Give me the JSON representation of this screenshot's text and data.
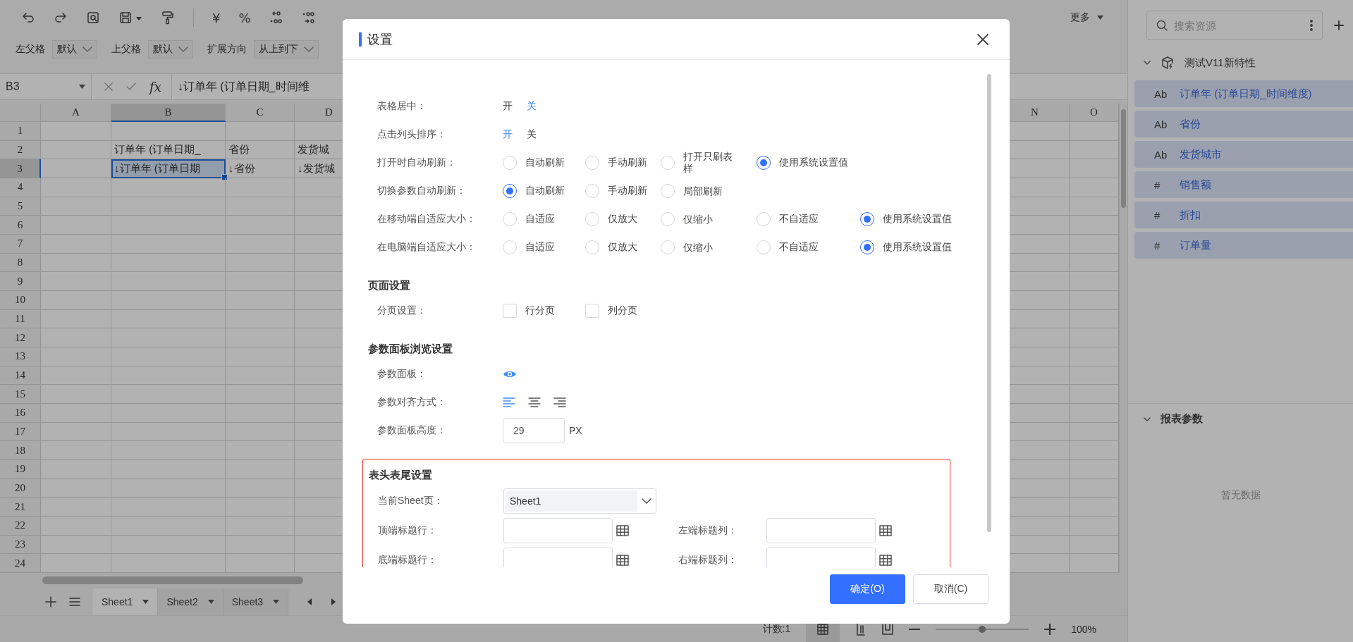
{
  "toolbar": {
    "items": [
      {
        "kind": "undo"
      },
      {
        "kind": "redo"
      },
      {
        "kind": "preview"
      },
      {
        "kind": "save"
      },
      {
        "kind": "format-painter"
      },
      {
        "kind": "separator"
      },
      {
        "kind": "glyph",
        "text": "¥"
      },
      {
        "kind": "glyph",
        "text": "%"
      },
      {
        "kind": "decimal-add"
      },
      {
        "kind": "decimal-remove"
      }
    ],
    "more": "更多"
  },
  "cell_properties": [
    {
      "label": "左父格",
      "value": "默认"
    },
    {
      "label": "上父格",
      "value": "默认"
    },
    {
      "label": "扩展方向",
      "value": "从上到下"
    }
  ],
  "formula_bar": {
    "cell_ref": "B3",
    "function_label": "fx",
    "formula": "↓订单年 (订单日期_时间维"
  },
  "sheet": {
    "columns": [
      {
        "label": "A",
        "selected": false
      },
      {
        "label": "B",
        "selected": true
      },
      {
        "label": "C",
        "selected": false
      },
      {
        "label": "D",
        "selected": false
      },
      {
        "label": "N",
        "selected": false
      },
      {
        "label": "O",
        "selected": false
      }
    ],
    "rows": [
      {
        "label": "1",
        "selected": false
      },
      {
        "label": "2",
        "selected": false,
        "cells": [
          {},
          {
            "text": "订单年 (订单日期_",
            "selected": false
          },
          {
            "text": "省份",
            "selected": false
          },
          {
            "text": "发货城",
            "selected": false
          }
        ]
      },
      {
        "label": "3",
        "selected": true,
        "cells": [
          {},
          {
            "text": "↓订单年 (订单日期",
            "selected": true
          },
          {
            "text": "↓省份",
            "selected": false
          },
          {
            "text": "↓发货城",
            "selected": false
          }
        ]
      },
      {
        "label": "4",
        "selected": false
      },
      {
        "label": "5",
        "selected": false
      },
      {
        "label": "6",
        "selected": false
      },
      {
        "label": "7",
        "selected": false
      },
      {
        "label": "8",
        "selected": false
      },
      {
        "label": "9",
        "selected": false
      },
      {
        "label": "10",
        "selected": false
      },
      {
        "label": "11",
        "selected": false
      },
      {
        "label": "12",
        "selected": false
      },
      {
        "label": "13",
        "selected": false
      },
      {
        "label": "14",
        "selected": false
      },
      {
        "label": "15",
        "selected": false
      },
      {
        "label": "16",
        "selected": false
      },
      {
        "label": "17",
        "selected": false
      },
      {
        "label": "18",
        "selected": false
      },
      {
        "label": "19",
        "selected": false
      },
      {
        "label": "20",
        "selected": false
      },
      {
        "label": "21",
        "selected": false
      },
      {
        "label": "22",
        "selected": false
      },
      {
        "label": "23",
        "selected": false
      },
      {
        "label": "24",
        "selected": false
      }
    ]
  },
  "sheet_tabs": [
    {
      "label": "Sheet1",
      "selected": true
    },
    {
      "label": "Sheet2",
      "selected": false
    },
    {
      "label": "Sheet3",
      "selected": false
    }
  ],
  "status_bar": {
    "count": "计数:1",
    "zoom": {
      "level": 0.5,
      "reading": "100%"
    }
  },
  "resource_panel": {
    "search": {
      "placeholder": "搜索资源"
    },
    "dataset": {
      "label": "测试V11新特性",
      "expanded": true,
      "children": [
        {
          "glyph": "Ab",
          "label": "订单年 (订单日期_时间维度)"
        },
        {
          "glyph": "Ab",
          "label": "省份"
        },
        {
          "glyph": "Ab",
          "label": "发货城市"
        },
        {
          "glyph": "#",
          "label": "销售额"
        },
        {
          "glyph": "#",
          "label": "折扣"
        },
        {
          "glyph": "#",
          "label": "订单量"
        }
      ]
    },
    "parameters": {
      "label": "报表参数",
      "expanded": true,
      "empty_text": "暂无数据"
    }
  },
  "dialog": {
    "title": "设置",
    "sections": [
      {
        "highlighted": false,
        "rows": [
          {
            "kind": "toggle",
            "label": "表格居中：",
            "options": [
              {
                "label": "开",
                "selected": false
              },
              {
                "label": "关",
                "selected": true
              }
            ]
          },
          {
            "kind": "toggle",
            "label": "点击列头排序：",
            "options": [
              {
                "label": "开",
                "selected": true
              },
              {
                "label": "关",
                "selected": false
              }
            ]
          },
          {
            "kind": "radio",
            "label": "打开时自动刷新：",
            "options": [
              {
                "label": "自动刷新",
                "selected": false
              },
              {
                "label": "手动刷新",
                "selected": false
              },
              {
                "label": "打开只刷表样",
                "selected": false
              },
              {
                "label": "使用系统设置值",
                "selected": true
              }
            ]
          },
          {
            "kind": "radio",
            "label": "切换参数自动刷新：",
            "options": [
              {
                "label": "自动刷新",
                "selected": true
              },
              {
                "label": "手动刷新",
                "selected": false
              },
              {
                "label": "局部刷新",
                "selected": false
              }
            ]
          },
          {
            "kind": "radio",
            "label": "在移动端自适应大小：",
            "options": [
              {
                "label": "自适应",
                "selected": false
              },
              {
                "label": "仅放大",
                "selected": false
              },
              {
                "label": "仅缩小",
                "selected": false
              },
              {
                "label": "不自适应",
                "selected": false
              },
              {
                "label": "使用系统设置值",
                "selected": true
              }
            ]
          },
          {
            "kind": "radio",
            "label": "在电脑端自适应大小：",
            "options": [
              {
                "label": "自适应",
                "selected": false
              },
              {
                "label": "仅放大",
                "selected": false
              },
              {
                "label": "仅缩小",
                "selected": false
              },
              {
                "label": "不自适应",
                "selected": false
              },
              {
                "label": "使用系统设置值",
                "selected": true
              }
            ]
          }
        ]
      },
      {
        "title": "页面设置",
        "highlighted": false,
        "rows": [
          {
            "kind": "checkbox",
            "label": "分页设置：",
            "options": [
              {
                "label": "行分页",
                "checked": false
              },
              {
                "label": "列分页",
                "checked": false
              }
            ]
          }
        ]
      },
      {
        "title": "参数面板浏览设置",
        "highlighted": false,
        "rows": [
          {
            "kind": "visibility",
            "label": "参数面板：",
            "visible": true
          },
          {
            "kind": "align",
            "label": "参数对齐方式：",
            "options": [
              {
                "kind": "left",
                "selected": true
              },
              {
                "kind": "center",
                "selected": false
              },
              {
                "kind": "right",
                "selected": false
              }
            ]
          },
          {
            "kind": "number",
            "label": "参数面板高度：",
            "value": "29",
            "unit": "PX"
          }
        ]
      },
      {
        "title": "表头表尾设置",
        "highlighted": true,
        "rows": [
          {
            "kind": "select",
            "label": "当前Sheet页：",
            "value": "Sheet1"
          },
          {
            "kind": "range_pair",
            "fields": [
              {
                "label": "顶端标题行："
              },
              {
                "label": "左端标题列："
              }
            ]
          },
          {
            "kind": "range_pair",
            "fields": [
              {
                "label": "底端标题行："
              },
              {
                "label": "右端标题列："
              }
            ]
          }
        ]
      }
    ],
    "buttons": [
      {
        "label": "确定(O)",
        "primary": true
      },
      {
        "label": "取消(C)",
        "primary": false
      }
    ]
  }
}
